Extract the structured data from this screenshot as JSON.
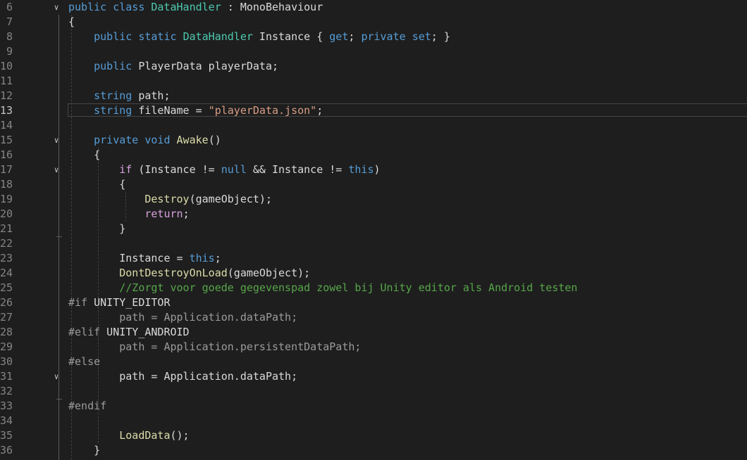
{
  "editor": {
    "current_line": 13,
    "lines": [
      {
        "num": "6",
        "fold": true,
        "tokens": [
          [
            "public",
            "keyword"
          ],
          [
            " ",
            "plain"
          ],
          [
            "class",
            "keyword"
          ],
          [
            " ",
            "plain"
          ],
          [
            "DataHandler",
            "type"
          ],
          [
            " : ",
            "plain"
          ],
          [
            "MonoBehaviour",
            "ident"
          ]
        ]
      },
      {
        "num": "7",
        "fold": false,
        "tokens": [
          [
            "{",
            "plain"
          ]
        ]
      },
      {
        "num": "8",
        "fold": false,
        "tokens": [
          [
            "    ",
            "plain"
          ],
          [
            "public",
            "keyword"
          ],
          [
            " ",
            "plain"
          ],
          [
            "static",
            "keyword"
          ],
          [
            " ",
            "plain"
          ],
          [
            "DataHandler",
            "type"
          ],
          [
            " Instance { ",
            "plain"
          ],
          [
            "get",
            "keyword"
          ],
          [
            "; ",
            "plain"
          ],
          [
            "private",
            "keyword"
          ],
          [
            " ",
            "plain"
          ],
          [
            "set",
            "keyword"
          ],
          [
            "; }",
            "plain"
          ]
        ]
      },
      {
        "num": "9",
        "fold": false,
        "tokens": []
      },
      {
        "num": "10",
        "fold": false,
        "tokens": [
          [
            "    ",
            "plain"
          ],
          [
            "public",
            "keyword"
          ],
          [
            " PlayerData playerData;",
            "plain"
          ]
        ]
      },
      {
        "num": "11",
        "fold": false,
        "tokens": []
      },
      {
        "num": "12",
        "fold": false,
        "tokens": [
          [
            "    ",
            "plain"
          ],
          [
            "string",
            "keyword"
          ],
          [
            " path;",
            "plain"
          ]
        ]
      },
      {
        "num": "13",
        "fold": false,
        "tokens": [
          [
            "    ",
            "plain"
          ],
          [
            "string",
            "keyword"
          ],
          [
            " fileName = ",
            "plain"
          ],
          [
            "\"playerData.json\"",
            "string"
          ],
          [
            ";",
            "plain"
          ]
        ]
      },
      {
        "num": "14",
        "fold": false,
        "tokens": []
      },
      {
        "num": "15",
        "fold": true,
        "tokens": [
          [
            "    ",
            "plain"
          ],
          [
            "private",
            "keyword"
          ],
          [
            " ",
            "plain"
          ],
          [
            "void",
            "keyword"
          ],
          [
            " ",
            "plain"
          ],
          [
            "Awake",
            "method"
          ],
          [
            "()",
            "plain"
          ]
        ]
      },
      {
        "num": "16",
        "fold": false,
        "tokens": [
          [
            "    {",
            "plain"
          ]
        ]
      },
      {
        "num": "17",
        "fold": true,
        "tokens": [
          [
            "        ",
            "plain"
          ],
          [
            "if",
            "control"
          ],
          [
            " (Instance != ",
            "plain"
          ],
          [
            "null",
            "keyword"
          ],
          [
            " && Instance != ",
            "plain"
          ],
          [
            "this",
            "keyword"
          ],
          [
            ")",
            "plain"
          ]
        ]
      },
      {
        "num": "18",
        "fold": false,
        "tokens": [
          [
            "        {",
            "plain"
          ]
        ]
      },
      {
        "num": "19",
        "fold": false,
        "tokens": [
          [
            "            ",
            "plain"
          ],
          [
            "Destroy",
            "method"
          ],
          [
            "(gameObject);",
            "plain"
          ]
        ]
      },
      {
        "num": "20",
        "fold": false,
        "tokens": [
          [
            "            ",
            "plain"
          ],
          [
            "return",
            "control"
          ],
          [
            ";",
            "plain"
          ]
        ]
      },
      {
        "num": "21",
        "fold": false,
        "tokens": [
          [
            "        }",
            "plain"
          ]
        ]
      },
      {
        "num": "22",
        "fold": false,
        "tokens": []
      },
      {
        "num": "23",
        "fold": false,
        "tokens": [
          [
            "        Instance = ",
            "plain"
          ],
          [
            "this",
            "keyword"
          ],
          [
            ";",
            "plain"
          ]
        ]
      },
      {
        "num": "24",
        "fold": false,
        "tokens": [
          [
            "        ",
            "plain"
          ],
          [
            "DontDestroyOnLoad",
            "method"
          ],
          [
            "(gameObject);",
            "plain"
          ]
        ]
      },
      {
        "num": "25",
        "fold": false,
        "tokens": [
          [
            "        ",
            "plain"
          ],
          [
            "//Zorgt voor goede gegevenspad zowel bij Unity editor als Android testen",
            "comment"
          ]
        ]
      },
      {
        "num": "26",
        "fold": false,
        "tokens": [
          [
            "#if",
            "preproc"
          ],
          [
            " UNITY_EDITOR",
            "plain"
          ]
        ]
      },
      {
        "num": "27",
        "fold": false,
        "tokens": [
          [
            "        path = Application.dataPath;",
            "inactive"
          ]
        ]
      },
      {
        "num": "28",
        "fold": false,
        "tokens": [
          [
            "#elif",
            "preproc"
          ],
          [
            " UNITY_ANDROID",
            "plain"
          ]
        ]
      },
      {
        "num": "29",
        "fold": false,
        "tokens": [
          [
            "        path = Application.persistentDataPath;",
            "inactive"
          ]
        ]
      },
      {
        "num": "30",
        "fold": false,
        "tokens": [
          [
            "#else",
            "preproc"
          ]
        ]
      },
      {
        "num": "31",
        "fold": true,
        "tokens": [
          [
            "        path = Application.dataPath;",
            "plain"
          ]
        ]
      },
      {
        "num": "32",
        "fold": false,
        "tokens": []
      },
      {
        "num": "33",
        "fold": false,
        "tokens": [
          [
            "#endif",
            "preproc"
          ]
        ]
      },
      {
        "num": "34",
        "fold": false,
        "tokens": []
      },
      {
        "num": "35",
        "fold": false,
        "tokens": [
          [
            "        ",
            "plain"
          ],
          [
            "LoadData",
            "method"
          ],
          [
            "();",
            "plain"
          ]
        ]
      },
      {
        "num": "36",
        "fold": false,
        "tokens": [
          [
            "    }",
            "plain"
          ]
        ]
      }
    ]
  },
  "icons": {
    "fold": "chevron-down-icon"
  },
  "colors": {
    "background": "#1e1e1e",
    "line_number": "#858585",
    "line_number_active": "#c6c6c6",
    "keyword": "#569cd6",
    "control": "#d8a0df",
    "type": "#4ec9b0",
    "method": "#dcdcaa",
    "string": "#d69d85",
    "comment": "#57a64a",
    "text": "#dadada",
    "preprocessor": "#9b9b9b"
  }
}
